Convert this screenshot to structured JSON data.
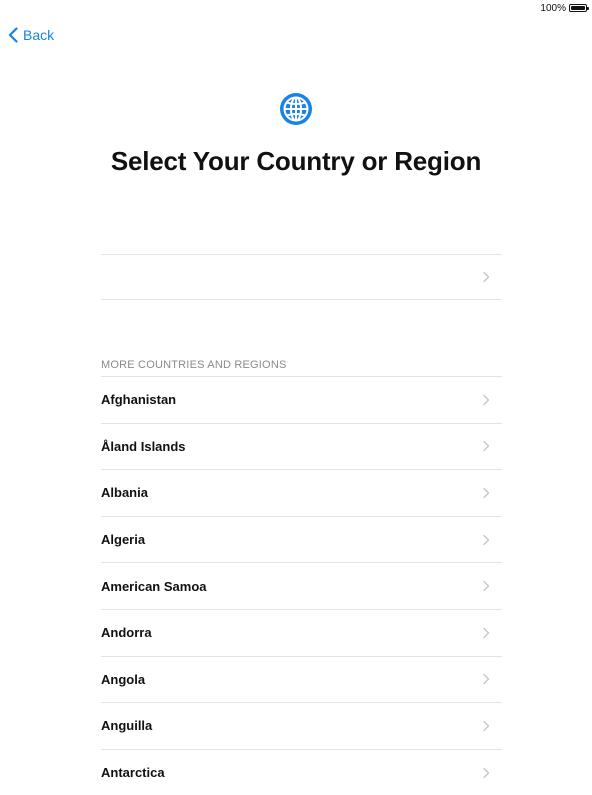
{
  "status_bar": {
    "battery_percent": "100%",
    "battery_level": 1.0
  },
  "nav": {
    "back_label": "Back",
    "accent_color": "#1a82e2"
  },
  "header": {
    "icon": "globe-icon",
    "title": "Select Your Country or Region"
  },
  "suggested": {
    "label": ""
  },
  "more_section": {
    "header": "MORE COUNTRIES AND REGIONS",
    "items": [
      {
        "label": "Afghanistan"
      },
      {
        "label": "Åland Islands"
      },
      {
        "label": "Albania"
      },
      {
        "label": "Algeria"
      },
      {
        "label": "American Samoa"
      },
      {
        "label": "Andorra"
      },
      {
        "label": "Angola"
      },
      {
        "label": "Anguilla"
      },
      {
        "label": "Antarctica"
      }
    ]
  }
}
